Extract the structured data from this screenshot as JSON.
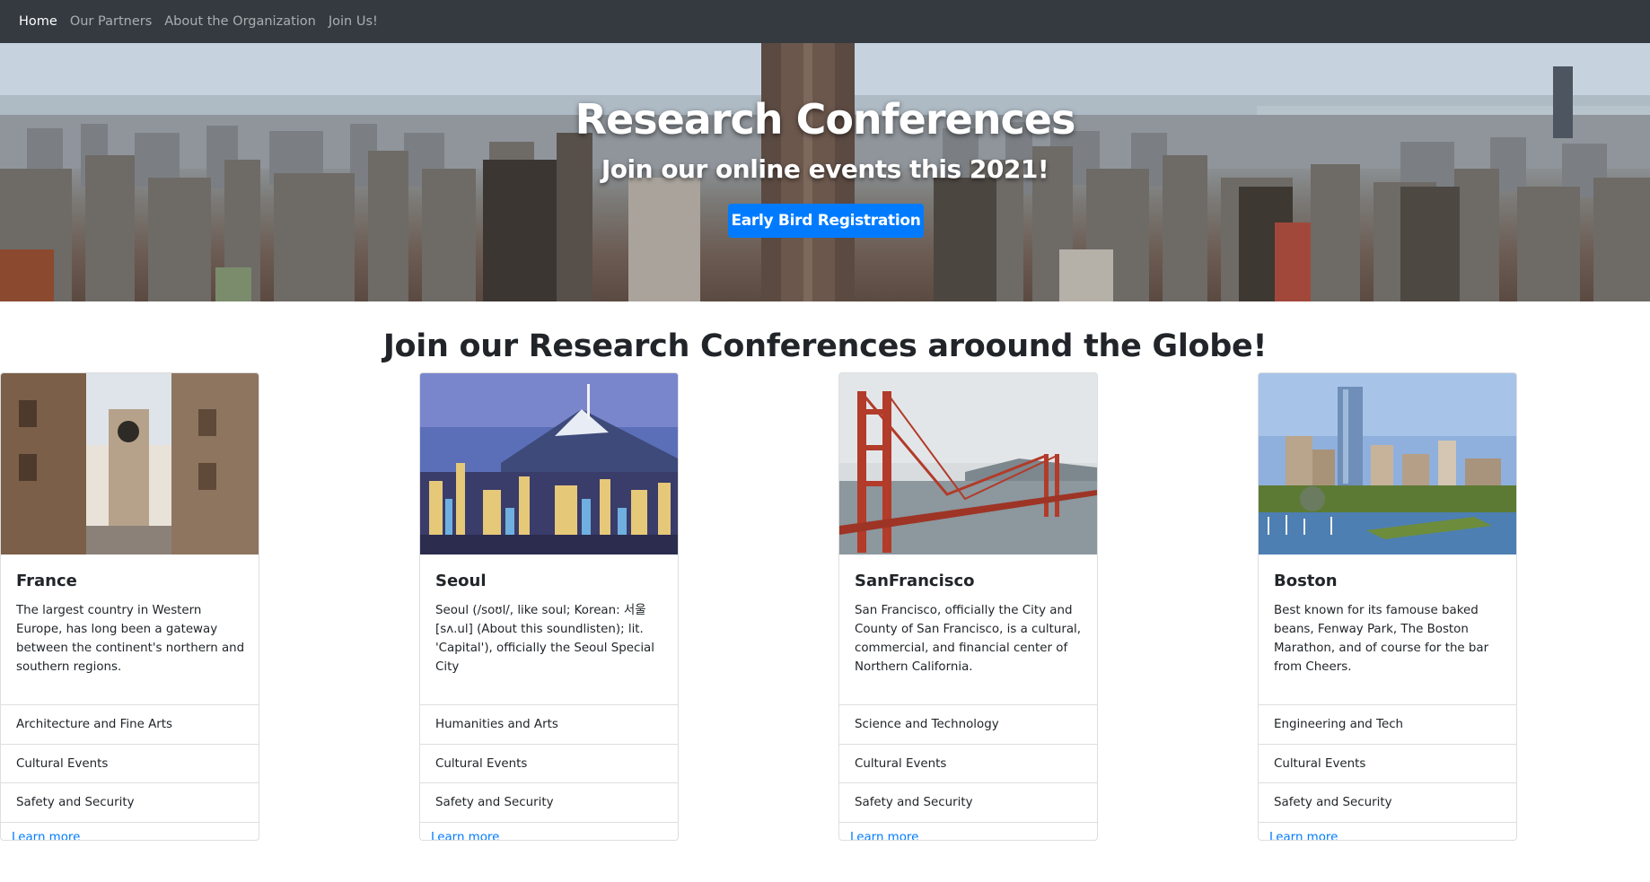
{
  "navbar": {
    "items": [
      {
        "label": "Home",
        "active": true
      },
      {
        "label": "Our Partners",
        "active": false
      },
      {
        "label": "About the Organization",
        "active": false
      },
      {
        "label": "Join Us!",
        "active": false
      }
    ]
  },
  "hero": {
    "title": "Research Conferences",
    "subtitle": "Join our online events this 2021!",
    "button_label": "Early Bird Registration"
  },
  "section": {
    "heading": "Join our Research Conferences aroound the Globe!"
  },
  "cards": [
    {
      "title": "France",
      "text": "The largest country in Western Europe, has long been a gateway between the continent's northern and southern regions.",
      "items": [
        "Architecture and Fine Arts",
        "Cultural Events",
        "Safety and Security"
      ],
      "link": "Learn more"
    },
    {
      "title": "Seoul",
      "text": "Seoul (/soʊl/, like soul; Korean: 서울 [sʌ.ul] (About this soundlisten); lit. 'Capital'), officially the Seoul Special City",
      "items": [
        "Humanities and Arts",
        "Cultural Events",
        "Safety and Security"
      ],
      "link": "Learn more"
    },
    {
      "title": "SanFrancisco",
      "text": "San Francisco, officially the City and County of San Francisco, is a cultural, commercial, and financial center of Northern California.",
      "items": [
        "Science and Technology",
        "Cultural Events",
        "Safety and Security"
      ],
      "link": "Learn more"
    },
    {
      "title": "Boston",
      "text": "Best known for its famouse baked beans, Fenway Park, The Boston Marathon, and of course for the bar from Cheers.",
      "items": [
        "Engineering and Tech",
        "Cultural Events",
        "Safety and Security"
      ],
      "link": "Learn more"
    }
  ],
  "colors": {
    "navbar_bg": "#343a40",
    "primary": "#007bff",
    "text": "#212529"
  }
}
